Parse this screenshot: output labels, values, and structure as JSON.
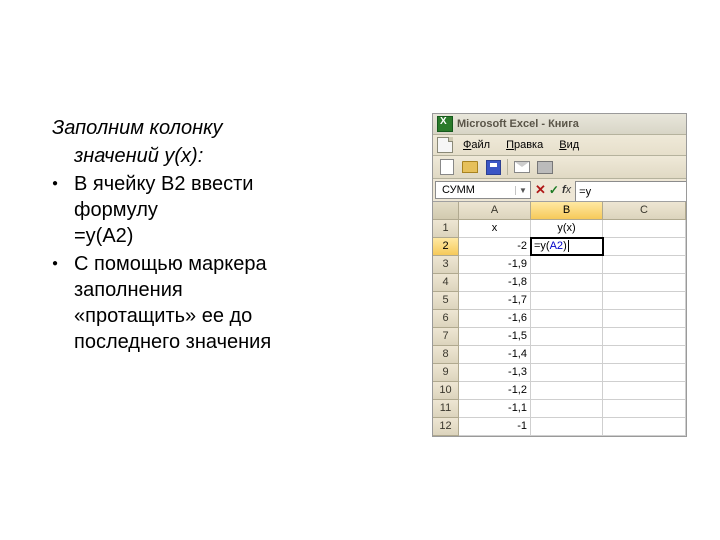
{
  "text": {
    "intro1": "Заполним колонку",
    "intro2": "значений y(x):",
    "li1a": "В ячейку B2 ввести",
    "li1b": "формулу",
    "li1c": "=y(A2)",
    "li2a": "С помощью маркера",
    "li2b": "заполнения",
    "li2c": "«протащить» ее до",
    "li2d": "последнего значения"
  },
  "excel": {
    "title": "Microsoft Excel - Книга",
    "menu": {
      "file": "Файл",
      "file_u": "Ф",
      "file_rest": "айл",
      "edit": "Правка",
      "edit_u": "П",
      "edit_rest": "равка",
      "view": "Вид",
      "view_u": "В",
      "view_rest": "ид"
    },
    "namebox": "СУММ",
    "formula_prefix": "=y",
    "col_a": "A",
    "col_b": "B",
    "col_c": "C",
    "header_a": "x",
    "header_b": "y(x)",
    "editing_prefix": "=y(",
    "editing_ref": "A2",
    "editing_suffix": ")",
    "rows": [
      {
        "n": "1",
        "a": "x",
        "b": "y(x)"
      },
      {
        "n": "2",
        "a": "-2",
        "b": ""
      },
      {
        "n": "3",
        "a": "-1,9",
        "b": ""
      },
      {
        "n": "4",
        "a": "-1,8",
        "b": ""
      },
      {
        "n": "5",
        "a": "-1,7",
        "b": ""
      },
      {
        "n": "6",
        "a": "-1,6",
        "b": ""
      },
      {
        "n": "7",
        "a": "-1,5",
        "b": ""
      },
      {
        "n": "8",
        "a": "-1,4",
        "b": ""
      },
      {
        "n": "9",
        "a": "-1,3",
        "b": ""
      },
      {
        "n": "10",
        "a": "-1,2",
        "b": ""
      },
      {
        "n": "11",
        "a": "-1,1",
        "b": ""
      },
      {
        "n": "12",
        "a": "-1",
        "b": ""
      }
    ]
  }
}
